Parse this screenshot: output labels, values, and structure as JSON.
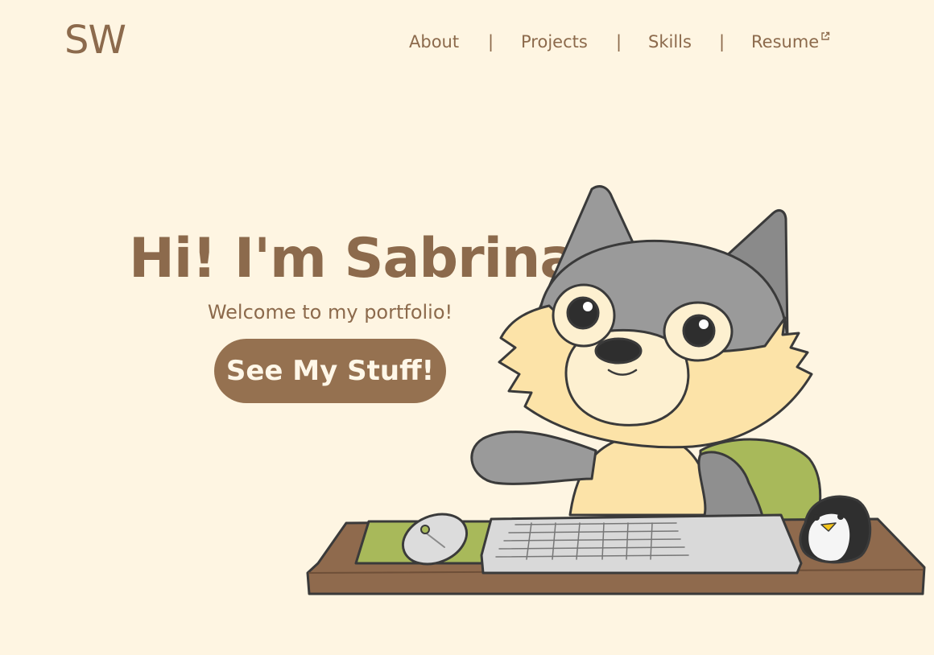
{
  "header": {
    "logo": "SW",
    "nav": {
      "about": "About",
      "projects": "Projects",
      "skills": "Skills",
      "resume": "Resume",
      "separator": "|"
    }
  },
  "hero": {
    "title": "Hi! I'm Sabrina.",
    "subtitle": "Welcome to my portfolio!",
    "cta_label": "See My Stuff!"
  },
  "icons": {
    "resume": "external-link-icon"
  },
  "colors": {
    "background": "#fef5e2",
    "brown": "#8c6a4c",
    "button": "#957150",
    "button_text": "#fff7e8"
  }
}
